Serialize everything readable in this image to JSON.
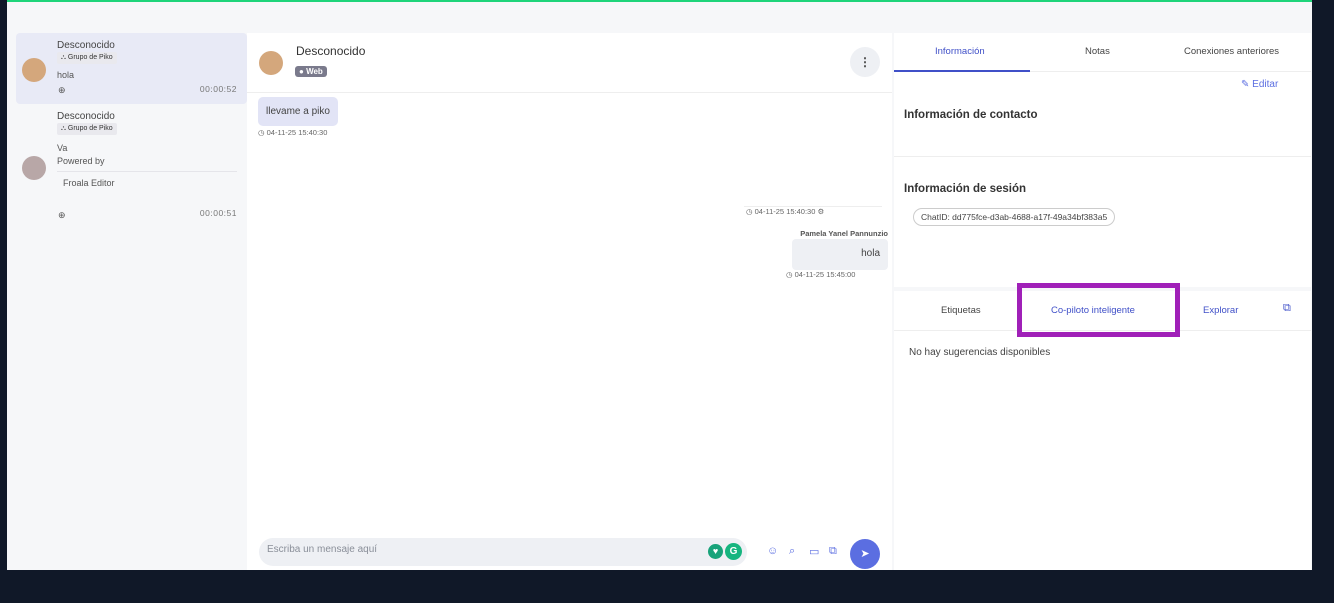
{
  "conversations": [
    {
      "name": "Desconocido",
      "group": "Grupo de Piko",
      "message": "hola",
      "time": "00:00:52",
      "avatar_color": "#d4a77c",
      "active": true
    },
    {
      "name": "Desconocido",
      "group": "Grupo de Piko",
      "message": "Va",
      "message2": "Powered by",
      "message3": "Froala Editor",
      "time": "00:00:51",
      "avatar_color": "#b8a7a7",
      "active": false
    }
  ],
  "chat": {
    "contact_name": "Desconocido",
    "channel_badge": "Web",
    "messages": [
      {
        "text": "llevame a piko",
        "timestamp": "04-11-25 15:40:30",
        "direction": "in"
      },
      {
        "timestamp_system": "04-11-25 15:40:30"
      },
      {
        "sender": "Pamela Yanel Pannunzio",
        "text": "hola",
        "timestamp": "04-11-25 15:45:00",
        "direction": "out"
      }
    ],
    "composer_placeholder": "Escriba un mensaje aquí"
  },
  "panel": {
    "tabs": [
      "Información",
      "Notas",
      "Conexiones anteriores"
    ],
    "edit_label": "Editar",
    "contact_info_title": "Información de contacto",
    "session_info_title": "Información de sesión",
    "chat_id": "ChatID: dd775fce-d3ab-4688-a17f-49a34bf383a5",
    "tabs2": [
      "Etiquetas",
      "Co-piloto inteligente",
      "Explorar"
    ],
    "no_suggestions": "No hay sugerencias disponibles"
  },
  "colors": {
    "accent": "#5b6ee1",
    "highlight": "#a020b8",
    "top_border": "#1ed47a"
  }
}
